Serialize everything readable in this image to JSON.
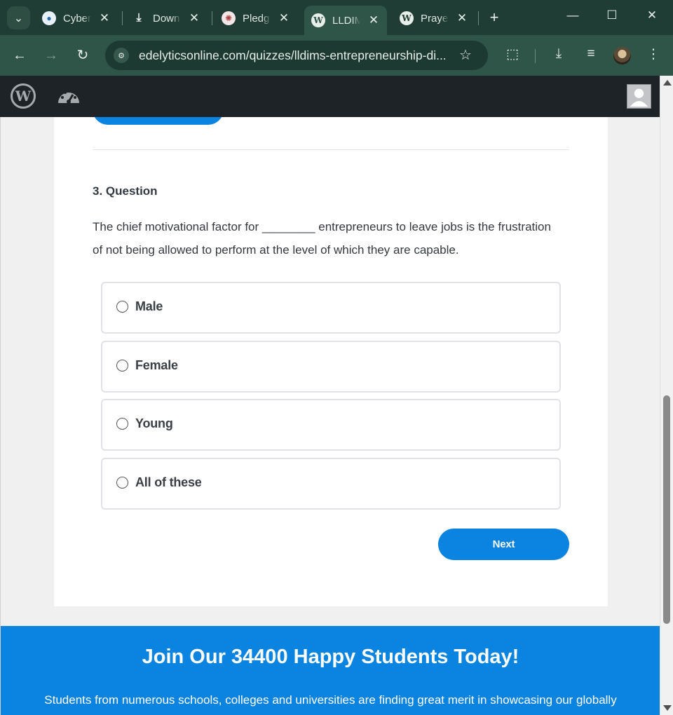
{
  "browser": {
    "tabs": [
      {
        "label": "Cyber",
        "favicon": "cyber-favicon",
        "active": false
      },
      {
        "label": "Down",
        "favicon": "download-icon",
        "active": false
      },
      {
        "label": "Pledg",
        "favicon": "pledge-favicon",
        "active": false
      },
      {
        "label": "LLDIM",
        "favicon": "wordpress-icon",
        "active": true
      },
      {
        "label": "Praye",
        "favicon": "wordpress-icon",
        "active": false
      }
    ],
    "url": "edelyticsonline.com/quizzes/lldims-entrepreneurship-di..."
  },
  "quiz": {
    "question_title": "3. Question",
    "question_text": "The chief motivational factor for ________ entrepreneurs to leave jobs is the frustration of not being allowed to perform at the level of which they are capable.",
    "answers": [
      "Male",
      "Female",
      "Young",
      "All of these"
    ],
    "next_label": "Next"
  },
  "cta": {
    "title": "Join Our 34400 Happy Students Today!",
    "text": "Students from numerous schools, colleges and universities are finding great merit in showcasing our globally"
  },
  "colors": {
    "accent": "#0a84e0",
    "chrome_dark": "#1f3d34",
    "chrome_toolbar": "#2f5448",
    "admin_bar": "#1d2327"
  }
}
